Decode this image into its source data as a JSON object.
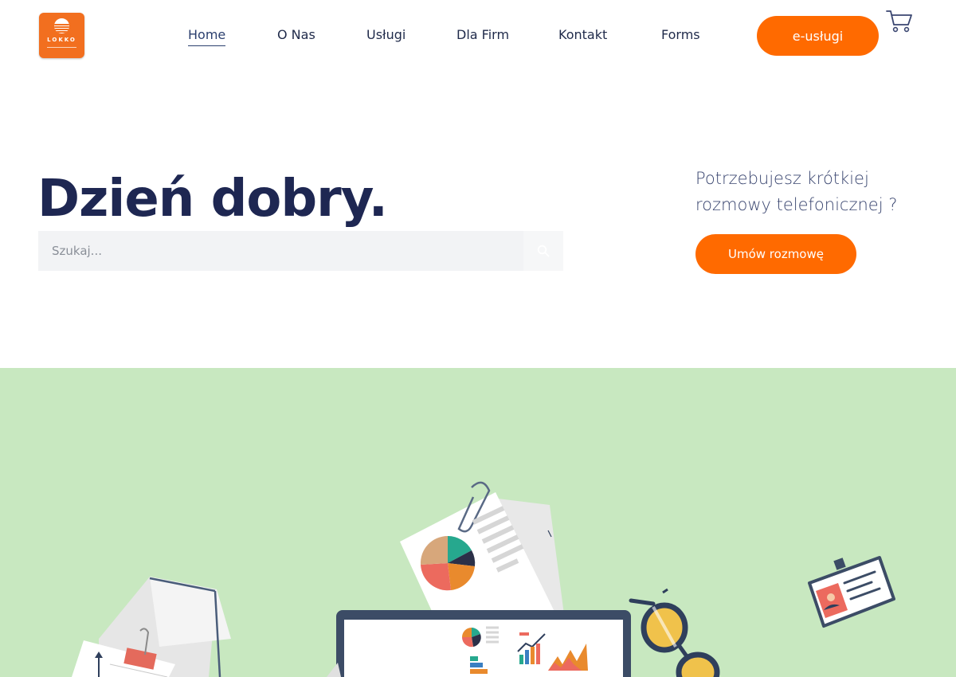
{
  "logo": {
    "text": "LOKKO"
  },
  "nav": {
    "items": [
      {
        "label": "Home",
        "active": true
      },
      {
        "label": "O Nas",
        "active": false
      },
      {
        "label": "Usługi",
        "active": false
      },
      {
        "label": "Dla Firm",
        "active": false
      },
      {
        "label": "Kontakt",
        "active": false
      },
      {
        "label": "Forms",
        "active": false
      }
    ],
    "cta_label": "e-usługi",
    "cart_icon": "cart-icon"
  },
  "hero": {
    "greeting": "Dzień dobry.",
    "search_placeholder": "Szukaj...",
    "search_icon": "search-icon",
    "callout": "Potrzebujesz krótkiej rozmowy telefonicznej ?",
    "callout_button": "Umów rozmowę"
  },
  "colors": {
    "accent": "#ff6a00",
    "heading": "#1e2752",
    "band_background": "#c8e8c0"
  }
}
